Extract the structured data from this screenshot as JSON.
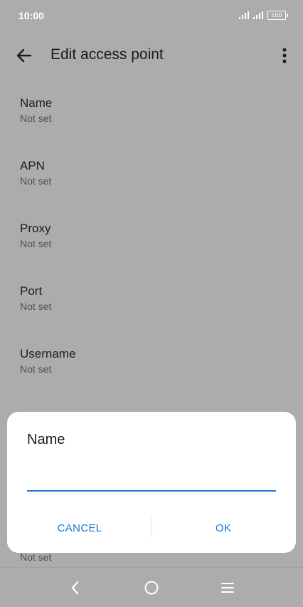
{
  "status_bar": {
    "time": "10:00",
    "battery": "100"
  },
  "app_bar": {
    "title": "Edit access point"
  },
  "settings": [
    {
      "label": "Name",
      "value": "Not set"
    },
    {
      "label": "APN",
      "value": "Not set"
    },
    {
      "label": "Proxy",
      "value": "Not set"
    },
    {
      "label": "Port",
      "value": "Not set"
    },
    {
      "label": "Username",
      "value": "Not set"
    }
  ],
  "hidden_item_value": "Not set",
  "dialog": {
    "title": "Name",
    "input_value": "",
    "cancel_label": "CANCEL",
    "ok_label": "OK"
  },
  "colors": {
    "accent": "#1e76d4",
    "scrim_background": "#acacac",
    "dialog_background": "#ffffff"
  },
  "icons": {
    "back": "arrow-left-icon",
    "more": "more-vert-icon",
    "nav_back": "chevron-left-icon",
    "nav_home": "circle-home-icon",
    "nav_menu": "menu-lines-icon"
  }
}
